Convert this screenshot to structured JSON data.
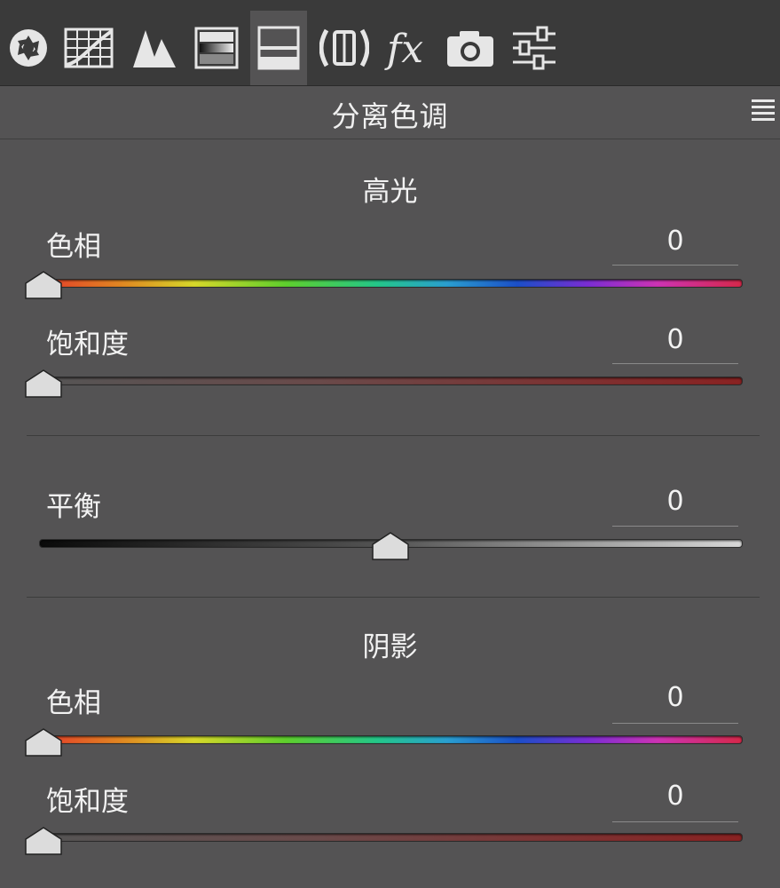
{
  "toolbar": {
    "tabs": [
      {
        "icon": "aperture-icon"
      },
      {
        "icon": "tone-curve-icon"
      },
      {
        "icon": "detail-icon"
      },
      {
        "icon": "hsl-icon"
      },
      {
        "icon": "split-toning-icon",
        "active": true
      },
      {
        "icon": "lens-correction-icon"
      },
      {
        "icon": "fx-icon"
      },
      {
        "icon": "camera-calibration-icon"
      },
      {
        "icon": "presets-icon"
      }
    ]
  },
  "panel": {
    "title": "分离色调"
  },
  "highlights": {
    "title": "高光",
    "hue": {
      "label": "色相",
      "value": "0"
    },
    "saturation": {
      "label": "饱和度",
      "value": "0"
    }
  },
  "balance": {
    "label": "平衡",
    "value": "0",
    "fraction": 0.5
  },
  "shadows": {
    "title": "阴影",
    "hue": {
      "label": "色相",
      "value": "0"
    },
    "saturation": {
      "label": "饱和度",
      "value": "0"
    }
  },
  "colors": {
    "panel_bg": "#545354",
    "tabbar_bg": "#3a3a3a",
    "text": "#f2f2f2"
  }
}
